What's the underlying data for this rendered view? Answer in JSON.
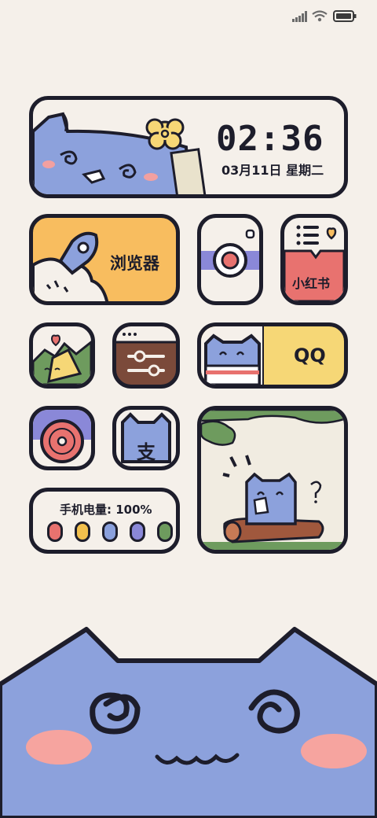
{
  "status_bar": {
    "icons": [
      "signal-icon",
      "wifi-icon",
      "battery-icon"
    ]
  },
  "clock_widget": {
    "time": "02:36",
    "date": "03月11日 星期二"
  },
  "apps": {
    "browser": {
      "label": "浏览器"
    },
    "camera": {
      "label": "",
      "icon": "camera-icon"
    },
    "xiaohongshu": {
      "label": "小红书"
    },
    "gallery": {
      "icon": "gallery-icon"
    },
    "settings": {
      "icon": "settings-sliders-icon"
    },
    "qq": {
      "label": "QQ"
    },
    "music": {
      "icon": "music-disc-icon"
    },
    "alipay": {
      "label": "支"
    }
  },
  "battery_widget": {
    "label": "手机电量: 100%",
    "dot_colors": [
      "#e8726f",
      "#f2c04d",
      "#8aa0dc",
      "#8a88d8",
      "#6e9b5e"
    ]
  },
  "colors": {
    "outline": "#1d1d2b",
    "cat_blue": "#8ca1dc",
    "cream": "#f5f0ea",
    "orange": "#f8bd5f",
    "red": "#e8726f",
    "yellow": "#f6d776",
    "purple": "#8a88d8"
  }
}
